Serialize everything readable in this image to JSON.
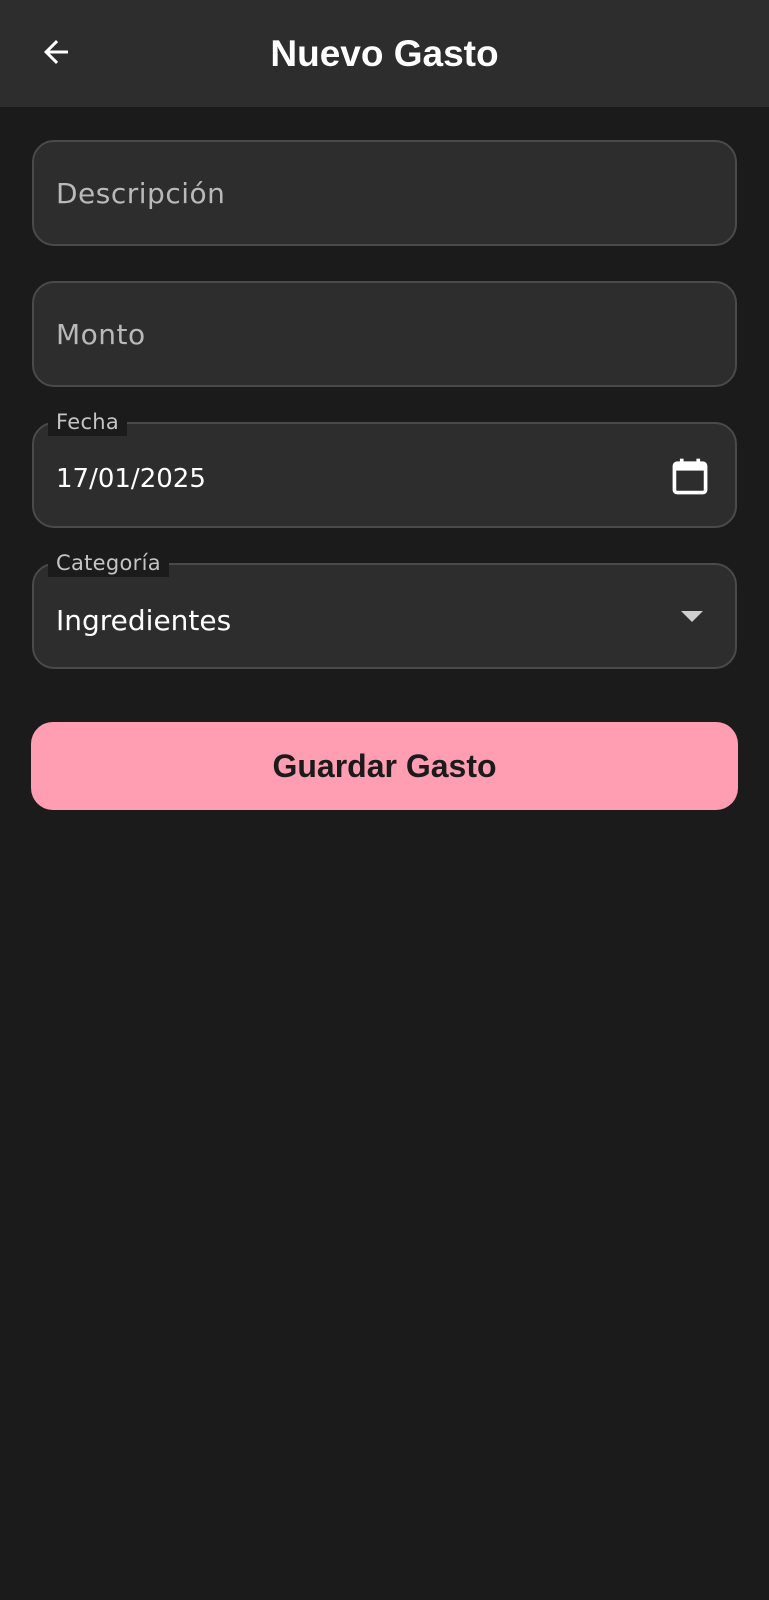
{
  "appbar": {
    "title": "Nuevo Gasto",
    "back_icon": "arrow-left-icon"
  },
  "form": {
    "description": {
      "placeholder": "Descripción",
      "value": ""
    },
    "amount": {
      "placeholder": "Monto",
      "value": ""
    },
    "date": {
      "label": "Fecha",
      "value": "17/01/2025",
      "icon": "calendar-icon"
    },
    "category": {
      "label": "Categoría",
      "value": "Ingredientes",
      "icon": "dropdown-arrow-icon"
    },
    "save_label": "Guardar Gasto"
  },
  "colors": {
    "background": "#1b1b1b",
    "appbar": "#2d2d2d",
    "field_fill": "#2d2d2d",
    "field_border": "#4a4a4a",
    "accent": "#ff9eb2"
  }
}
